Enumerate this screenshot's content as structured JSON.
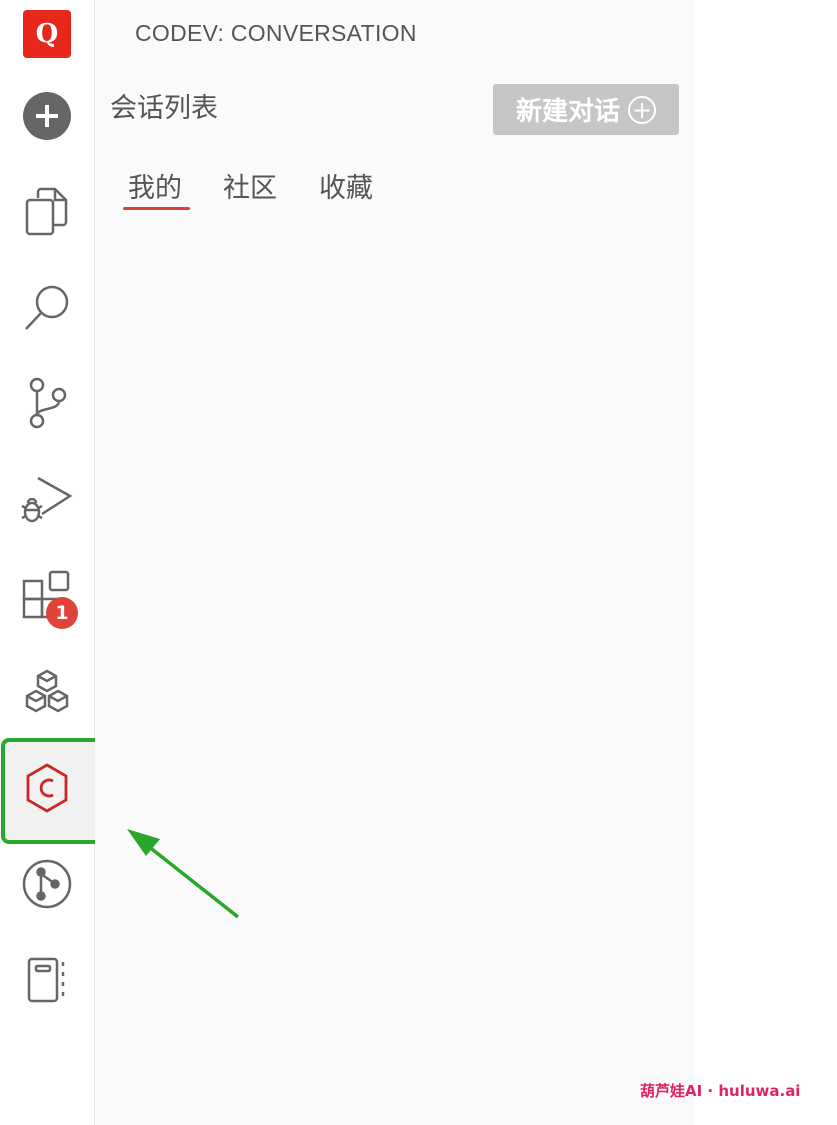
{
  "app": {
    "logo_letter": "Q",
    "brand_color": "#e8271c"
  },
  "activity_bar": {
    "items": [
      {
        "icon": "add-circle-icon"
      },
      {
        "icon": "explorer-files-icon"
      },
      {
        "icon": "search-icon"
      },
      {
        "icon": "source-control-icon"
      },
      {
        "icon": "run-debug-icon"
      },
      {
        "icon": "extensions-icon",
        "badge": "1"
      },
      {
        "icon": "packages-icon"
      },
      {
        "icon": "codev-icon",
        "active": true
      },
      {
        "icon": "git-graph-icon"
      },
      {
        "icon": "notebook-icon"
      }
    ],
    "extensions_badge": "1",
    "highlight_color": "#27a82a"
  },
  "panel": {
    "title": "CODEV: CONVERSATION",
    "section_title": "会话列表",
    "new_button_label": "新建对话",
    "tabs": [
      "我的",
      "社区",
      "收藏"
    ],
    "active_tab": "我的",
    "accent_color": "#d9423a"
  },
  "watermark": "葫芦娃AI · huluwa.ai"
}
